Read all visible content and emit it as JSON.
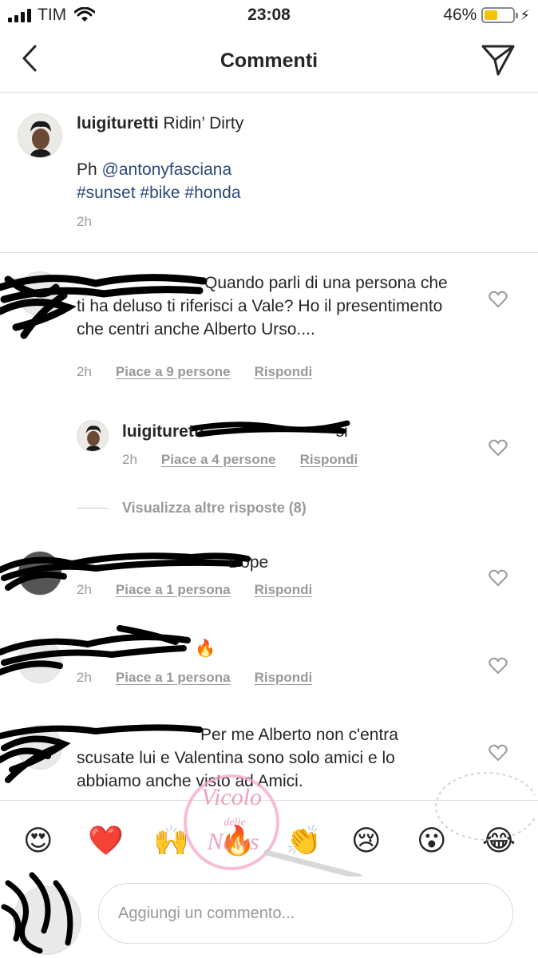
{
  "status": {
    "carrier": "TIM",
    "time": "23:08",
    "battery": "46%",
    "battery_level": 0.46
  },
  "header": {
    "title": "Commenti"
  },
  "caption": {
    "username": "luigituretti",
    "text": "Ridin’ Dirty",
    "line2_prefix": "Ph ",
    "mention": "@antonyfasciana",
    "hashtags": "#sunset #bike #honda",
    "time": "2h"
  },
  "comments": [
    {
      "text": "Quando parli di una persona che ti ha deluso ti riferisci a Vale? Ho il presentimento che centri anche Alberto Urso....",
      "time": "2h",
      "likes": "Piace a 9 persone",
      "reply": "Rispondi"
    },
    {
      "username": "luigituretti",
      "text": "si",
      "time": "2h",
      "likes": "Piace a 4 persone",
      "reply": "Rispondi"
    },
    {
      "text": "Dope",
      "time": "2h",
      "likes": "Piace a 1 persona",
      "reply": "Rispondi"
    },
    {
      "text": "🔥",
      "time": "2h",
      "likes": "Piace a 1 persona",
      "reply": "Rispondi"
    },
    {
      "text": "Per me Alberto non c'entra scusate lui e Valentina sono solo amici e lo abbiamo anche visto ad Amici."
    }
  ],
  "view_more": "Visualizza altre risposte (8)",
  "emojis": [
    "😍",
    "❤️",
    "🙌",
    "🔥",
    "👏",
    "😢",
    "😮",
    "😂"
  ],
  "composer": {
    "placeholder": "Aggiungi un commento..."
  },
  "watermark": {
    "line1": "Vicolo",
    "line2": "delle",
    "line3": "News"
  }
}
